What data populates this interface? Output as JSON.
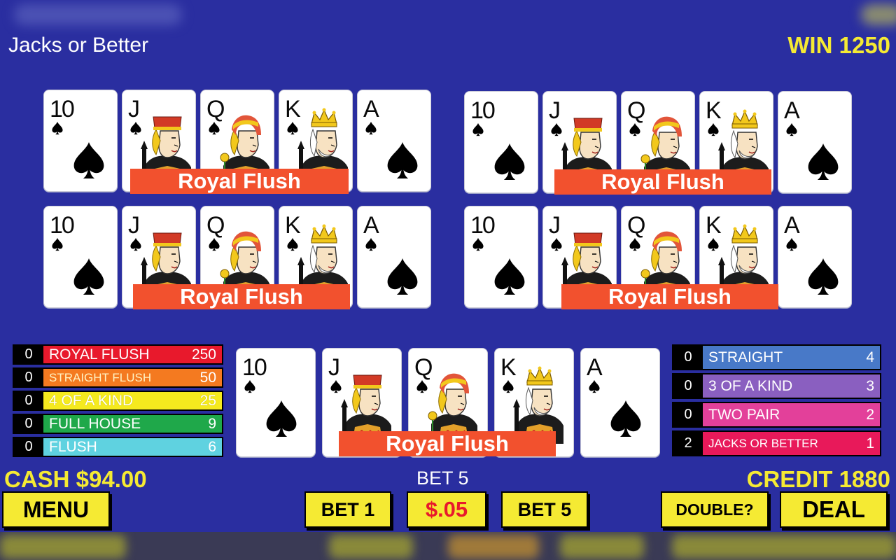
{
  "title": "Jacks or Better",
  "win": "WIN 1250",
  "card_ranks": [
    "10",
    "J",
    "Q",
    "K",
    "A"
  ],
  "card_suit_icon": "spade-icon",
  "hand_result": "Royal Flush",
  "hands": [
    {
      "result": "Royal Flush"
    },
    {
      "result": "Royal Flush"
    },
    {
      "result": "Royal Flush"
    },
    {
      "result": "Royal Flush"
    },
    {
      "result": "Royal Flush"
    }
  ],
  "paytable_left": [
    {
      "count": "0",
      "name": "ROYAL FLUSH",
      "value": "250",
      "color": "#e8192c"
    },
    {
      "count": "0",
      "name": "STRAIGHT FLUSH",
      "value": "50",
      "color": "#f47a20"
    },
    {
      "count": "0",
      "name": "4 OF A KIND",
      "value": "25",
      "color": "#f5ea1e"
    },
    {
      "count": "0",
      "name": "FULL HOUSE",
      "value": "9",
      "color": "#1fa84a"
    },
    {
      "count": "0",
      "name": "FLUSH",
      "value": "6",
      "color": "#5fd2e0"
    }
  ],
  "paytable_right": [
    {
      "count": "0",
      "name": "STRAIGHT",
      "value": "4",
      "color": "#4879c8"
    },
    {
      "count": "0",
      "name": "3 OF A KIND",
      "value": "3",
      "color": "#8a5fc0"
    },
    {
      "count": "0",
      "name": "TWO PAIR",
      "value": "2",
      "color": "#e3409a"
    },
    {
      "count": "2",
      "name": "JACKS OR BETTER",
      "value": "1",
      "color": "#e8195a"
    }
  ],
  "cash": "CASH $94.00",
  "bet": "BET 5",
  "credit": "CREDIT 1880",
  "buttons": {
    "menu": "MENU",
    "bet1": "BET 1",
    "denom": "$.05",
    "bet5": "BET 5",
    "double": "DOUBLE?",
    "deal": "DEAL"
  },
  "colors": {
    "background": "#2a2ea0",
    "button": "#f5ea33",
    "hand_label": "#f2512e",
    "yellow_text": "#f5ea33",
    "denom_text": "#e8192c"
  }
}
